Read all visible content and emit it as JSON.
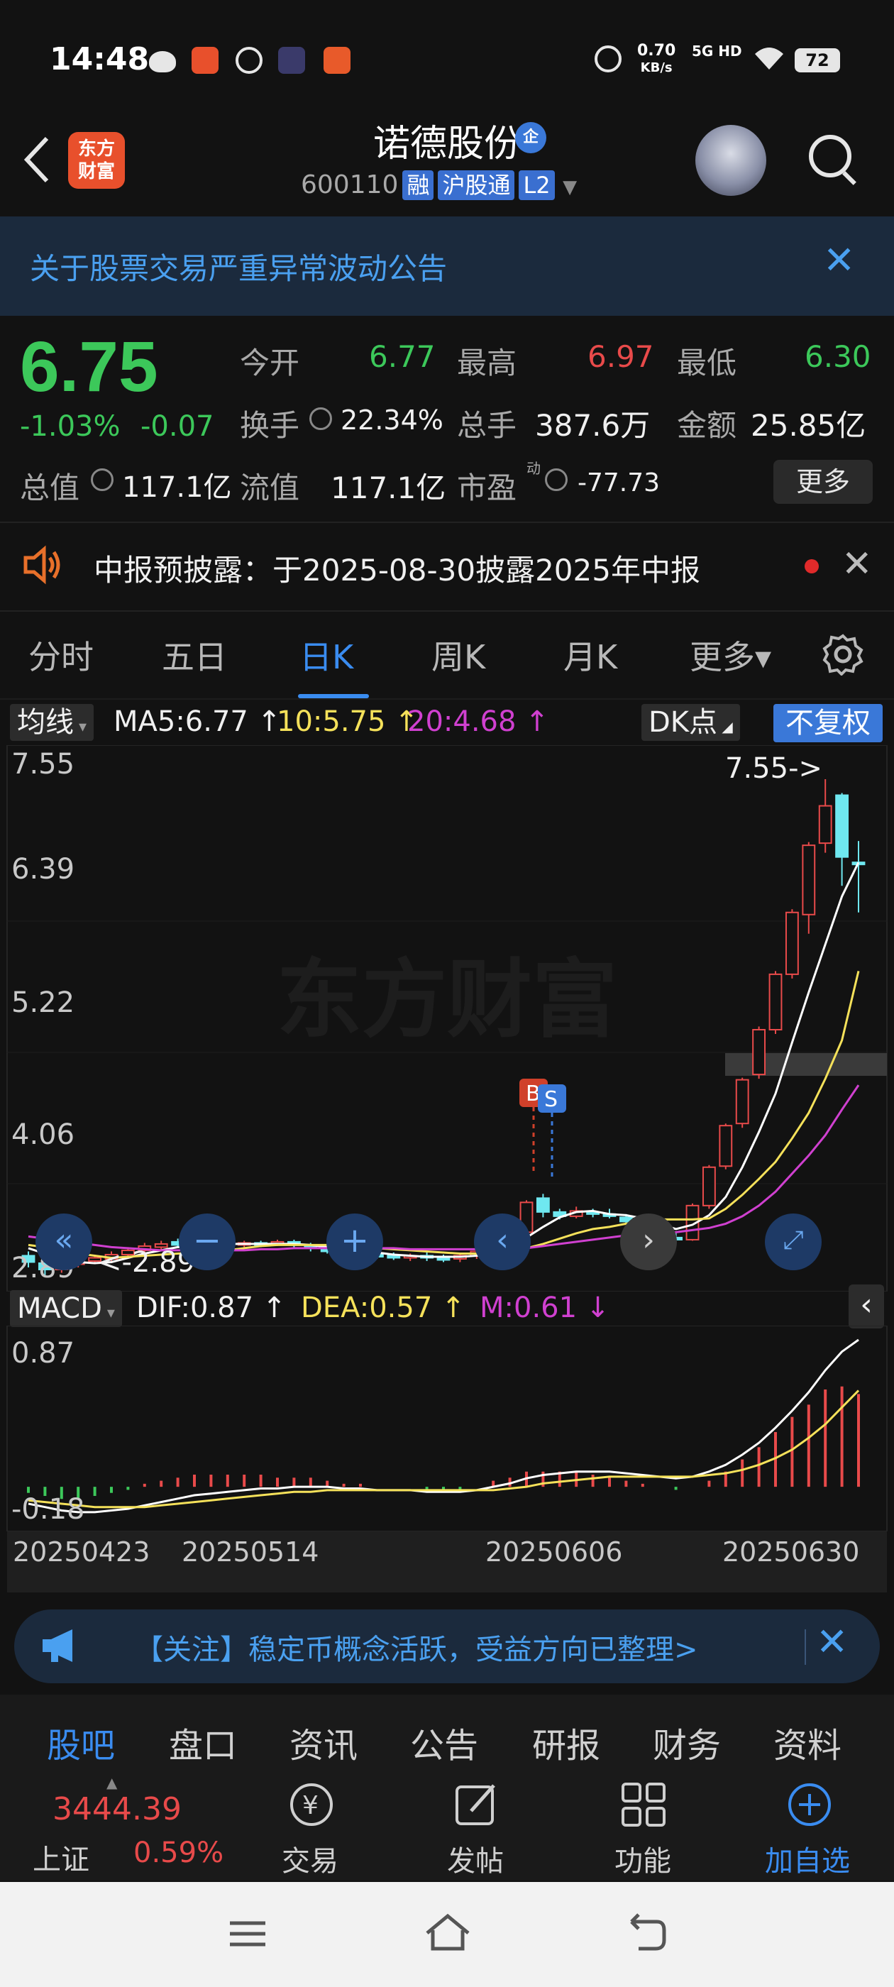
{
  "status_bar": {
    "time": "14:48",
    "net_speed": "0.70",
    "net_unit": "KB/s",
    "signal": "5G HD",
    "battery": "72"
  },
  "header": {
    "back_icon": "chevron-left",
    "logo_line1": "东方",
    "logo_line2": "财富",
    "stock_name": "诺德股份",
    "badge": "企",
    "stock_code": "600110",
    "tags": [
      "融",
      "沪股通",
      "L2"
    ]
  },
  "notice_banner": {
    "text": "关于股票交易严重异常波动公告"
  },
  "quote": {
    "price": "6.75",
    "change_pct": "-1.03%",
    "change_abs": "-0.07",
    "open_label": "今开",
    "open_value": "6.77",
    "high_label": "最高",
    "high_value": "6.97",
    "low_label": "最低",
    "low_value": "6.30",
    "turnover_label": "换手",
    "turnover_value": "22.34%",
    "volume_label": "总手",
    "volume_value": "387.6万",
    "amount_label": "金额",
    "amount_value": "25.85亿",
    "mktcap_label": "总值",
    "mktcap_value": "117.1亿",
    "float_label": "流值",
    "float_value": "117.1亿",
    "pe_label": "市盈",
    "pe_sup": "动",
    "pe_value": "-77.73",
    "more_label": "更多"
  },
  "notice2": {
    "text": "中报预披露：于2025-08-30披露2025年中报"
  },
  "chart_tabs": [
    "分时",
    "五日",
    "日K",
    "周K",
    "月K",
    "更多▾"
  ],
  "active_tab": "日K",
  "ma_row": {
    "selector": "均线",
    "ma5": "MA5:6.77 ↑",
    "ma10": "10:5.75 ↑",
    "ma20": "20:4.68 ↑",
    "dk": "DK点",
    "adjust": "不复权"
  },
  "kline": {
    "y_labels": [
      "7.55",
      "6.39",
      "5.22",
      "4.06",
      "2.89"
    ],
    "max_marker": "7.55->",
    "min_marker": "<-2.89",
    "watermark": "东方财富",
    "buy_marker": "B",
    "sell_marker": "S"
  },
  "macd_row": {
    "selector": "MACD",
    "dif": "DIF:0.87 ↑",
    "dea": "DEA:0.57 ↑",
    "m": "M:0.61 ↓"
  },
  "macd": {
    "y_labels": [
      "0.87",
      "-0.18"
    ]
  },
  "dates": [
    "20250423",
    "20250514",
    "20250606",
    "20250630"
  ],
  "ad": {
    "text": "【关注】稳定币概念活跃，受益方向已整理>"
  },
  "bottom_tabs": [
    "股吧",
    "盘口",
    "资讯",
    "公告",
    "研报",
    "财务",
    "资料"
  ],
  "toolbar": {
    "index_value": "3444.39",
    "index_name": "上证",
    "index_change": "0.59%",
    "trade": "交易",
    "post": "发帖",
    "function": "功能",
    "add_watch": "加自选"
  },
  "colors": {
    "up": "#e84a4a",
    "down": "#3cc85a",
    "accent": "#3a8cf0",
    "ma5": "#ffffff",
    "ma10": "#f5e15a",
    "ma20": "#d040d0",
    "bearish_candle": "#6fe8f0"
  },
  "chart_data": {
    "type": "candlestick",
    "x_labels": [
      "20250423",
      "20250514",
      "20250606",
      "20250630"
    ],
    "ylim": [
      2.89,
      7.55
    ],
    "candles": [
      {
        "o": 3.08,
        "c": 3.02,
        "h": 3.12,
        "l": 2.97
      },
      {
        "o": 3.01,
        "c": 2.95,
        "h": 3.04,
        "l": 2.89
      },
      {
        "o": 2.95,
        "c": 3.0,
        "h": 3.03,
        "l": 2.92
      },
      {
        "o": 3.0,
        "c": 3.04,
        "h": 3.07,
        "l": 2.97
      },
      {
        "o": 3.03,
        "c": 3.06,
        "h": 3.09,
        "l": 3.0
      },
      {
        "o": 3.05,
        "c": 3.09,
        "h": 3.12,
        "l": 3.02
      },
      {
        "o": 3.09,
        "c": 3.13,
        "h": 3.16,
        "l": 3.06
      },
      {
        "o": 3.13,
        "c": 3.17,
        "h": 3.2,
        "l": 3.1
      },
      {
        "o": 3.16,
        "c": 3.19,
        "h": 3.22,
        "l": 3.13
      },
      {
        "o": 3.21,
        "c": 3.18,
        "h": 3.24,
        "l": 3.15
      },
      {
        "o": 3.17,
        "c": 3.19,
        "h": 3.22,
        "l": 3.14
      },
      {
        "o": 3.19,
        "c": 3.21,
        "h": 3.23,
        "l": 3.16
      },
      {
        "o": 3.22,
        "c": 3.18,
        "h": 3.24,
        "l": 3.15
      },
      {
        "o": 3.18,
        "c": 3.2,
        "h": 3.22,
        "l": 3.15
      },
      {
        "o": 3.2,
        "c": 3.19,
        "h": 3.22,
        "l": 3.16
      },
      {
        "o": 3.19,
        "c": 3.21,
        "h": 3.23,
        "l": 3.17
      },
      {
        "o": 3.21,
        "c": 3.18,
        "h": 3.23,
        "l": 3.15
      },
      {
        "o": 3.18,
        "c": 3.15,
        "h": 3.2,
        "l": 3.12
      },
      {
        "o": 3.14,
        "c": 3.12,
        "h": 3.17,
        "l": 3.1
      },
      {
        "o": 3.12,
        "c": 3.11,
        "h": 3.15,
        "l": 3.08
      },
      {
        "o": 3.11,
        "c": 3.09,
        "h": 3.13,
        "l": 3.06
      },
      {
        "o": 3.09,
        "c": 3.08,
        "h": 3.12,
        "l": 3.05
      },
      {
        "o": 3.08,
        "c": 3.07,
        "h": 3.11,
        "l": 3.04
      },
      {
        "o": 3.07,
        "c": 3.08,
        "h": 3.1,
        "l": 3.03
      },
      {
        "o": 3.08,
        "c": 3.06,
        "h": 3.11,
        "l": 3.03
      },
      {
        "o": 3.06,
        "c": 3.05,
        "h": 3.09,
        "l": 3.02
      },
      {
        "o": 3.05,
        "c": 3.08,
        "h": 3.1,
        "l": 3.02
      },
      {
        "o": 3.08,
        "c": 3.12,
        "h": 3.15,
        "l": 3.05
      },
      {
        "o": 3.12,
        "c": 3.2,
        "h": 3.25,
        "l": 3.1
      },
      {
        "o": 3.2,
        "c": 3.28,
        "h": 3.3,
        "l": 3.16
      },
      {
        "o": 3.3,
        "c": 3.58,
        "h": 3.6,
        "l": 3.26
      },
      {
        "o": 3.62,
        "c": 3.49,
        "h": 3.66,
        "l": 3.44
      },
      {
        "o": 3.49,
        "c": 3.45,
        "h": 3.52,
        "l": 3.42
      },
      {
        "o": 3.45,
        "c": 3.5,
        "h": 3.54,
        "l": 3.43
      },
      {
        "o": 3.49,
        "c": 3.47,
        "h": 3.52,
        "l": 3.44
      },
      {
        "o": 3.47,
        "c": 3.46,
        "h": 3.52,
        "l": 3.43
      },
      {
        "o": 3.44,
        "c": 3.4,
        "h": 3.47,
        "l": 3.37
      },
      {
        "o": 3.39,
        "c": 3.36,
        "h": 3.42,
        "l": 3.33
      },
      {
        "o": 3.33,
        "c": 3.25,
        "h": 3.37,
        "l": 3.22
      },
      {
        "o": 3.25,
        "c": 3.23,
        "h": 3.29,
        "l": 3.2
      },
      {
        "o": 3.23,
        "c": 3.55,
        "h": 3.57,
        "l": 3.22
      },
      {
        "o": 3.55,
        "c": 3.91,
        "h": 3.93,
        "l": 3.52
      },
      {
        "o": 3.92,
        "c": 4.3,
        "h": 4.32,
        "l": 3.89
      },
      {
        "o": 4.32,
        "c": 4.73,
        "h": 4.75,
        "l": 4.28
      },
      {
        "o": 4.78,
        "c": 5.2,
        "h": 5.23,
        "l": 4.74
      },
      {
        "o": 5.2,
        "c": 5.72,
        "h": 5.75,
        "l": 5.16
      },
      {
        "o": 5.72,
        "c": 6.3,
        "h": 6.33,
        "l": 5.68
      },
      {
        "o": 6.28,
        "c": 6.93,
        "h": 6.96,
        "l": 6.1
      },
      {
        "o": 6.95,
        "c": 7.3,
        "h": 7.55,
        "l": 6.86
      },
      {
        "o": 7.4,
        "c": 6.82,
        "h": 7.42,
        "l": 6.55
      },
      {
        "o": 6.77,
        "c": 6.75,
        "h": 6.97,
        "l": 6.3
      }
    ],
    "series": [
      {
        "name": "MA5",
        "values": [
          3.15,
          3.1,
          3.05,
          3.02,
          3.01,
          3.02,
          3.06,
          3.1,
          3.13,
          3.16,
          3.17,
          3.19,
          3.19,
          3.19,
          3.19,
          3.19,
          3.19,
          3.18,
          3.16,
          3.15,
          3.13,
          3.11,
          3.09,
          3.08,
          3.07,
          3.07,
          3.07,
          3.08,
          3.11,
          3.15,
          3.25,
          3.35,
          3.44,
          3.49,
          3.5,
          3.47,
          3.46,
          3.43,
          3.38,
          3.33,
          3.37,
          3.46,
          3.63,
          3.91,
          4.24,
          4.6,
          5.08,
          5.55,
          6.0,
          6.45,
          6.77
        ]
      },
      {
        "name": "10",
        "values": [
          3.18,
          3.16,
          3.13,
          3.1,
          3.08,
          3.06,
          3.07,
          3.08,
          3.09,
          3.1,
          3.11,
          3.12,
          3.13,
          3.15,
          3.17,
          3.18,
          3.18,
          3.18,
          3.18,
          3.17,
          3.16,
          3.15,
          3.14,
          3.13,
          3.12,
          3.11,
          3.1,
          3.1,
          3.1,
          3.11,
          3.15,
          3.19,
          3.24,
          3.29,
          3.33,
          3.35,
          3.38,
          3.4,
          3.42,
          3.42,
          3.42,
          3.43,
          3.52,
          3.65,
          3.8,
          3.96,
          4.18,
          4.42,
          4.74,
          5.1,
          5.75
        ]
      },
      {
        "name": "20",
        "values": [
          3.26,
          3.24,
          3.22,
          3.2,
          3.18,
          3.16,
          3.15,
          3.14,
          3.13,
          3.13,
          3.13,
          3.13,
          3.13,
          3.13,
          3.14,
          3.14,
          3.15,
          3.15,
          3.15,
          3.15,
          3.15,
          3.15,
          3.15,
          3.14,
          3.14,
          3.14,
          3.14,
          3.14,
          3.14,
          3.14,
          3.15,
          3.17,
          3.19,
          3.21,
          3.23,
          3.25,
          3.27,
          3.28,
          3.29,
          3.3,
          3.32,
          3.34,
          3.38,
          3.45,
          3.55,
          3.68,
          3.85,
          4.02,
          4.21,
          4.45,
          4.68
        ]
      }
    ],
    "macd": {
      "ylim": [
        -0.18,
        0.87
      ],
      "dif": [
        -0.1,
        -0.12,
        -0.14,
        -0.15,
        -0.15,
        -0.14,
        -0.13,
        -0.11,
        -0.09,
        -0.07,
        -0.05,
        -0.04,
        -0.03,
        -0.02,
        -0.01,
        -0.01,
        0.0,
        0.0,
        0.0,
        -0.01,
        -0.01,
        -0.02,
        -0.02,
        -0.02,
        -0.03,
        -0.03,
        -0.03,
        -0.02,
        0.0,
        0.02,
        0.05,
        0.07,
        0.08,
        0.09,
        0.09,
        0.09,
        0.08,
        0.07,
        0.06,
        0.05,
        0.06,
        0.09,
        0.13,
        0.19,
        0.26,
        0.35,
        0.45,
        0.56,
        0.69,
        0.8,
        0.87
      ],
      "dea": [
        -0.08,
        -0.09,
        -0.1,
        -0.11,
        -0.12,
        -0.12,
        -0.12,
        -0.12,
        -0.11,
        -0.1,
        -0.09,
        -0.08,
        -0.07,
        -0.06,
        -0.05,
        -0.04,
        -0.03,
        -0.03,
        -0.02,
        -0.02,
        -0.02,
        -0.02,
        -0.02,
        -0.02,
        -0.02,
        -0.02,
        -0.02,
        -0.02,
        -0.02,
        -0.01,
        0.0,
        0.02,
        0.03,
        0.04,
        0.05,
        0.06,
        0.06,
        0.06,
        0.06,
        0.06,
        0.06,
        0.07,
        0.08,
        0.1,
        0.13,
        0.17,
        0.22,
        0.29,
        0.37,
        0.47,
        0.57
      ],
      "hist": [
        -0.04,
        -0.06,
        -0.08,
        -0.08,
        -0.06,
        -0.04,
        -0.02,
        0.02,
        0.04,
        0.06,
        0.08,
        0.08,
        0.08,
        0.08,
        0.08,
        0.06,
        0.06,
        0.06,
        0.04,
        0.02,
        0.02,
        0.0,
        0.0,
        0.0,
        -0.02,
        -0.02,
        -0.02,
        0.0,
        0.04,
        0.06,
        0.1,
        0.1,
        0.1,
        0.1,
        0.08,
        0.06,
        0.04,
        0.02,
        0.0,
        -0.02,
        0.0,
        0.04,
        0.1,
        0.18,
        0.26,
        0.36,
        0.46,
        0.54,
        0.64,
        0.66,
        0.61
      ]
    }
  }
}
